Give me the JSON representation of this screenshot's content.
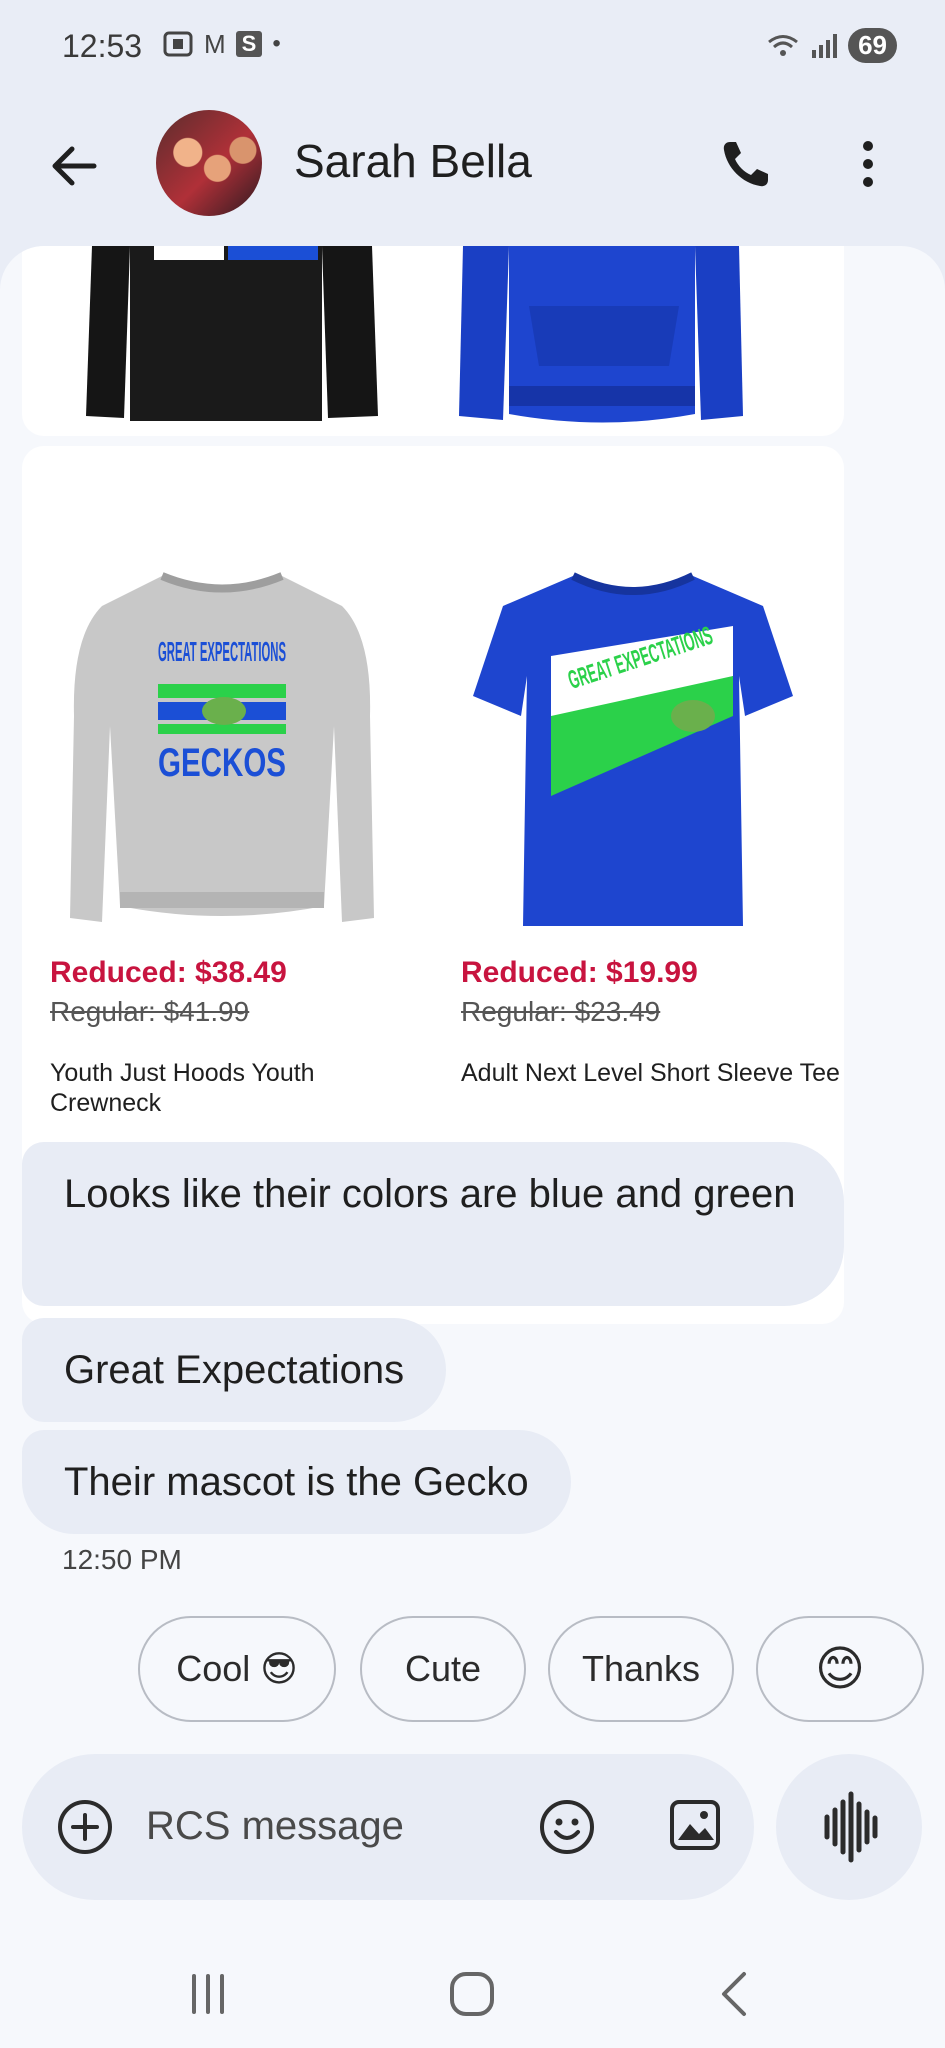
{
  "status_bar": {
    "time": "12:53",
    "icon_m": "M",
    "icon_s": "S",
    "icon_dot": "•",
    "battery": "69"
  },
  "header": {
    "contact_name": "Sarah Bella"
  },
  "products": [
    {
      "reduced": "Reduced: $38.49",
      "regular": "Regular: $41.99",
      "name": "Youth Just Hoods Youth Crewneck",
      "shirt_text_1": "GREAT EXPECTATIONS",
      "shirt_text_2": "GECKOS"
    },
    {
      "reduced": "Reduced: $19.99",
      "regular": "Regular: $23.49",
      "name": "Adult Next Level Short Sleeve Tee",
      "shirt_text_1": "GREAT EXPECTATIONS"
    }
  ],
  "messages": [
    {
      "text": "Looks like their colors are blue and green"
    },
    {
      "text": "Great Expectations"
    },
    {
      "text": "Their mascot is the Gecko"
    }
  ],
  "message_time": "12:50 PM",
  "smart_replies": [
    {
      "label": "Cool 😎"
    },
    {
      "label": "Cute"
    },
    {
      "label": "Thanks"
    },
    {
      "label": "😊"
    }
  ],
  "composer": {
    "placeholder": "RCS message"
  },
  "icons": {
    "back": "arrow-left-icon",
    "call": "phone-icon",
    "more": "more-vert-icon",
    "add": "plus-circle-icon",
    "emoji": "smiley-icon",
    "gallery": "image-icon",
    "voice": "audio-wave-icon"
  },
  "colors": {
    "reduced_price": "#c8143f",
    "bubble": "#e8ecf5",
    "background": "#e9edf6"
  }
}
